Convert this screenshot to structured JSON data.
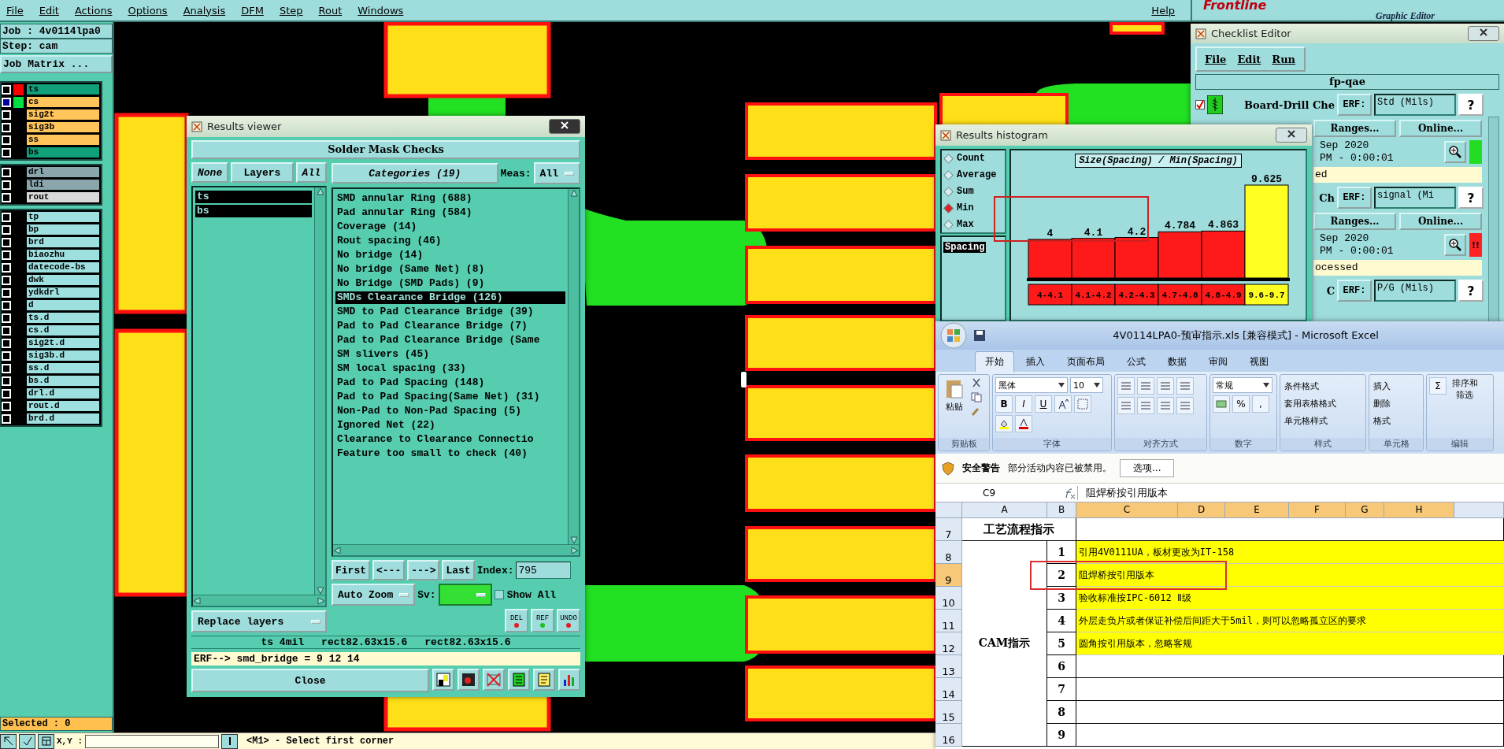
{
  "menu_bar": {
    "items": [
      "File",
      "Edit",
      "Actions",
      "Options",
      "Analysis",
      "DFM",
      "Step",
      "Rout",
      "Windows"
    ],
    "help": "Help"
  },
  "logo": {
    "name": "Frontline",
    "subtitle": "Graphic Editor"
  },
  "job_panel": {
    "job": "Job : 4v0114lpa0",
    "step": "Step: cam",
    "matrix_button": "Job Matrix ...",
    "layer_groups": [
      [
        {
          "name": "ts",
          "color": "#10a07a",
          "swatch": {
            "color": "#ff0000"
          },
          "selected": false
        },
        {
          "name": "cs",
          "color": "#ffc45a",
          "swatch": {
            "color": "#00e040"
          },
          "selected": true
        },
        {
          "name": "sig2t",
          "color": "#ffc45a",
          "selected": false
        },
        {
          "name": "sig3b",
          "color": "#ffc45a",
          "selected": false
        },
        {
          "name": "ss",
          "color": "#ffc45a",
          "selected": false
        },
        {
          "name": "bs",
          "color": "#10a07a",
          "selected": false
        }
      ],
      [
        {
          "name": "drl",
          "color": "#8aa6ac",
          "selected": false
        },
        {
          "name": "ldi",
          "color": "#8aa6ac",
          "selected": false
        },
        {
          "name": "rout",
          "color": "#d8d8d8",
          "selected": false
        }
      ],
      [
        {
          "name": "tp",
          "color": "#9ee0e0",
          "selected": false
        },
        {
          "name": "bp",
          "color": "#9ee0e0",
          "selected": false
        },
        {
          "name": "brd",
          "color": "#9ee0e0",
          "selected": false
        },
        {
          "name": "biaozhu",
          "color": "#9ee0e0",
          "selected": false
        },
        {
          "name": "datecode-bs",
          "color": "#9ee0e0",
          "selected": false
        },
        {
          "name": "dwk",
          "color": "#9ee0e0",
          "selected": false
        },
        {
          "name": "ydkdrl",
          "color": "#9ee0e0",
          "selected": false
        },
        {
          "name": "d",
          "color": "#9ee0e0",
          "selected": false
        },
        {
          "name": "ts.d",
          "color": "#9ee0e0",
          "selected": false
        },
        {
          "name": "cs.d",
          "color": "#9ee0e0",
          "selected": false
        },
        {
          "name": "sig2t.d",
          "color": "#9ee0e0",
          "selected": false
        },
        {
          "name": "sig3b.d",
          "color": "#9ee0e0",
          "selected": false
        },
        {
          "name": "ss.d",
          "color": "#9ee0e0",
          "selected": false
        },
        {
          "name": "bs.d",
          "color": "#9ee0e0",
          "selected": false
        },
        {
          "name": "drl.d",
          "color": "#9ee0e0",
          "selected": false
        },
        {
          "name": "rout.d",
          "color": "#9ee0e0",
          "selected": false
        },
        {
          "name": "brd.d",
          "color": "#9ee0e0",
          "selected": false
        }
      ]
    ],
    "selected_count": "Selected : 0"
  },
  "status_bar": {
    "xy_label": "X,Y :",
    "prompt": "<M1> - Select first corner"
  },
  "results_viewer": {
    "title": "Results viewer",
    "header": "Solder Mask Checks",
    "layer_buttons": [
      "None",
      "Layers",
      "All"
    ],
    "layers": [
      {
        "name": "ts",
        "selected": true
      },
      {
        "name": "bs",
        "selected": true
      }
    ],
    "categories_button": "Categories (19)",
    "meas_label": "Meas:",
    "meas_value": "All",
    "categories": [
      {
        "label": "SMD annular Ring (688)",
        "selected": false
      },
      {
        "label": "Pad annular Ring (584)",
        "selected": false
      },
      {
        "label": "Coverage (14)",
        "selected": false
      },
      {
        "label": "Rout spacing (46)",
        "selected": false
      },
      {
        "label": "No bridge (14)",
        "selected": false
      },
      {
        "label": "No bridge (Same Net) (8)",
        "selected": false
      },
      {
        "label": "No Bridge (SMD Pads) (9)",
        "selected": false
      },
      {
        "label": "SMDs Clearance Bridge (126)",
        "selected": true
      },
      {
        "label": "SMD to Pad Clearance Bridge (39)",
        "selected": false
      },
      {
        "label": "Pad to Pad Clearance Bridge (7)",
        "selected": false
      },
      {
        "label": "Pad to Pad Clearance Bridge (Same",
        "selected": false
      },
      {
        "label": "SM slivers (45)",
        "selected": false
      },
      {
        "label": "SM local spacing (33)",
        "selected": false
      },
      {
        "label": "Pad to Pad Spacing (148)",
        "selected": false
      },
      {
        "label": "Pad to Pad Spacing(Same Net) (31)",
        "selected": false
      },
      {
        "label": "Non-Pad to Non-Pad Spacing (5)",
        "selected": false
      },
      {
        "label": "Ignored Net (22)",
        "selected": false
      },
      {
        "label": "Clearance to Clearance Connectio",
        "selected": false
      },
      {
        "label": "Feature too small to check (40)",
        "selected": false
      }
    ],
    "nav_buttons": [
      "First",
      "<---",
      "--->",
      "Last"
    ],
    "index_label": "Index:",
    "index_value": "795",
    "zoom_mode": "Auto Zoom",
    "sv_label": "Sv:",
    "sv": {
      "color": "#33e033"
    },
    "show_all": {
      "label": "Show All",
      "checked": false
    },
    "action_buttons": [
      "DEL",
      "REF",
      "UNDO"
    ],
    "replace_mode": "Replace layers",
    "info": [
      "ts 4mil",
      "rect82.63x15.6",
      "rect82.63x15.6"
    ],
    "erf": "ERF--> smd_bridge = 9 12 14",
    "close": "Close"
  },
  "histogram": {
    "title": "Results histogram",
    "modes": [
      {
        "label": "Count",
        "selected": false
      },
      {
        "label": "Average",
        "selected": false
      },
      {
        "label": "Sum",
        "selected": false
      },
      {
        "label": "Min",
        "selected": true
      },
      {
        "label": "Max",
        "selected": false
      }
    ],
    "measures": [
      {
        "label": "Spacing",
        "selected": true
      }
    ],
    "chart_data": {
      "type": "bar",
      "title": "Size(Spacing) / Min(Spacing)",
      "categories": [
        "4-4.1",
        "4.1-4.2",
        "4.2-4.3",
        "4.7-4.8",
        "4.8-4.9",
        "9.6-9.7"
      ],
      "values": [
        4,
        4.1,
        4.2,
        4.784,
        4.863,
        9.625
      ],
      "data_labels": true
    },
    "bins": [
      {
        "color": "#ff1a1a",
        "annotated": true
      },
      {
        "color": "#ff1a1a",
        "annotated": true
      },
      {
        "color": "#ff1a1a",
        "annotated": true
      },
      {
        "color": "#ff1a1a",
        "annotated": false
      },
      {
        "color": "#ff1a1a",
        "annotated": false
      },
      {
        "color": "#ffff22",
        "annotated": false
      }
    ]
  },
  "checklist": {
    "title": "Checklist Editor",
    "menu": [
      "File",
      "Edit",
      "Run"
    ],
    "name": "fp-qae",
    "checks": [
      {
        "checked": true,
        "name": "Board-Drill Che",
        "erf": "ERF:",
        "units": "Std (Mils)",
        "help": "?",
        "ranges": "Ranges...",
        "online": "Online...",
        "date": "Sep 2020",
        "time": "PM - 0:00:01",
        "color": "#22dd22",
        "status_text": "ed"
      },
      {
        "name": "Ch",
        "erf": "ERF:",
        "units": "signal (Mi",
        "help": "?",
        "ranges": "Ranges...",
        "online": "Online...",
        "date": "Sep 2020",
        "time": "PM - 0:00:01",
        "color": "#ff2222",
        "alert": "!!",
        "status_text": "ocessed"
      },
      {
        "name": "C",
        "erf": "ERF:",
        "units": "P/G (Mils)",
        "help": "?"
      }
    ]
  },
  "excel": {
    "title": "4V0114LPA0-预审指示.xls  [兼容模式] - Microsoft Excel",
    "tabs": [
      {
        "label": "开始",
        "selected": true
      },
      {
        "label": "插入",
        "selected": false
      },
      {
        "label": "页面布局",
        "selected": false
      },
      {
        "label": "公式",
        "selected": false
      },
      {
        "label": "数据",
        "selected": false
      },
      {
        "label": "审阅",
        "selected": false
      },
      {
        "label": "视图",
        "selected": false
      }
    ],
    "ribbon": {
      "paste": "粘贴",
      "font": "黑体",
      "size": "10",
      "format_buttons": [
        "B",
        "I",
        "U"
      ],
      "number_format": "常规",
      "percent": "%",
      "comma": ",",
      "style_commands": [
        "条件格式",
        "套用表格格式",
        "单元格样式"
      ],
      "cell_commands": [
        "插入",
        "删除",
        "格式"
      ],
      "sum": "Σ",
      "sort": "排序和筛选",
      "groups": [
        "剪贴板",
        "字体",
        "对齐方式",
        "数字",
        "样式",
        "单元格",
        "编辑"
      ]
    },
    "security": {
      "title": "安全警告",
      "message": "部分活动内容已被禁用。",
      "button": "选项..."
    },
    "name_box": "C9",
    "formula": "阻焊桥按引用版本",
    "columns": [
      {
        "label": "A",
        "selected": false
      },
      {
        "label": "B",
        "selected": false
      },
      {
        "label": "C",
        "selected": true
      },
      {
        "label": "D",
        "selected": true
      },
      {
        "label": "E",
        "selected": true
      },
      {
        "label": "F",
        "selected": true
      },
      {
        "label": "G",
        "selected": true
      },
      {
        "label": "H",
        "selected": true
      }
    ],
    "heading_row": {
      "number": "7",
      "label": "工艺流程指示",
      "selected": false
    },
    "section_label": "CAM指示",
    "rows": [
      {
        "number": "8",
        "index": "1",
        "text": "引用4V0111UA，板材更改为IT-158",
        "highlight": true,
        "selected": false,
        "annotated": false
      },
      {
        "number": "9",
        "index": "2",
        "text": "阻焊桥按引用版本",
        "highlight": true,
        "selected": true,
        "annotated": true
      },
      {
        "number": "10",
        "index": "3",
        "text": "验收标准按IPC-6012 Ⅱ级",
        "highlight": true,
        "selected": false,
        "annotated": false
      },
      {
        "number": "11",
        "index": "4",
        "text": "外层走负片或者保证补偿后间距大于5mil，则可以忽略孤立区的要求",
        "highlight": true,
        "selected": false,
        "annotated": false
      },
      {
        "number": "12",
        "index": "5",
        "text": "圆角按引用版本，忽略客规",
        "highlight": true,
        "selected": false,
        "annotated": false
      },
      {
        "number": "13",
        "index": "6",
        "selected": false,
        "highlight": false,
        "annotated": false
      },
      {
        "number": "14",
        "index": "7",
        "selected": false,
        "highlight": false,
        "annotated": false
      },
      {
        "number": "15",
        "index": "8",
        "selected": false,
        "highlight": false,
        "annotated": false
      },
      {
        "number": "16",
        "index": "9",
        "selected": false,
        "highlight": false,
        "annotated": false
      }
    ]
  }
}
